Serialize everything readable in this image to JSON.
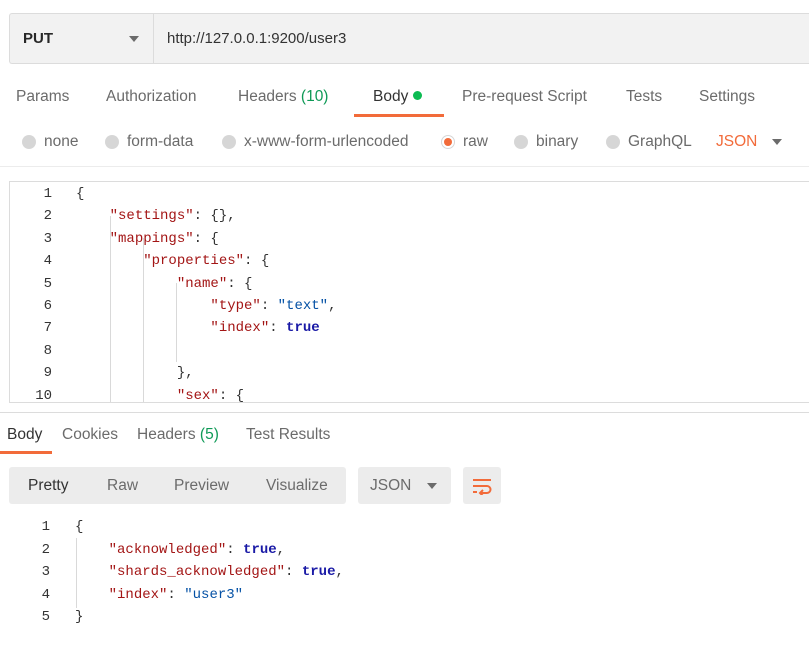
{
  "request": {
    "method": "PUT",
    "url": "http://127.0.0.1:9200/user3"
  },
  "request_tabs": [
    {
      "label": "Params"
    },
    {
      "label": "Authorization"
    },
    {
      "label": "Headers",
      "count": "(10)"
    },
    {
      "label": "Body",
      "active": true
    },
    {
      "label": "Pre-request Script"
    },
    {
      "label": "Tests"
    },
    {
      "label": "Settings"
    }
  ],
  "body_types": [
    {
      "label": "none"
    },
    {
      "label": "form-data"
    },
    {
      "label": "x-www-form-urlencoded"
    },
    {
      "label": "raw",
      "checked": true
    },
    {
      "label": "binary"
    },
    {
      "label": "GraphQL"
    }
  ],
  "raw_language": "JSON",
  "request_body_lines": [
    {
      "n": "1",
      "text": "{"
    },
    {
      "n": "2",
      "text": "    \"settings\": {},"
    },
    {
      "n": "3",
      "text": "    \"mappings\": {"
    },
    {
      "n": "4",
      "text": "        \"properties\": {"
    },
    {
      "n": "5",
      "text": "            \"name\": {"
    },
    {
      "n": "6",
      "text": "                \"type\": \"text\","
    },
    {
      "n": "7",
      "text": "                \"index\": true"
    },
    {
      "n": "8",
      "text": ""
    },
    {
      "n": "9",
      "text": "            },"
    },
    {
      "n": "10",
      "text": "            \"sex\": {"
    }
  ],
  "response_tabs": [
    {
      "label": "Body",
      "active": true
    },
    {
      "label": "Cookies"
    },
    {
      "label": "Headers",
      "count": "(5)"
    },
    {
      "label": "Test Results"
    }
  ],
  "view_modes": [
    {
      "label": "Pretty",
      "active": true
    },
    {
      "label": "Raw"
    },
    {
      "label": "Preview"
    },
    {
      "label": "Visualize"
    }
  ],
  "response_format": "JSON",
  "response_body_lines": [
    {
      "n": "1",
      "text": "{"
    },
    {
      "n": "2",
      "text": "    \"acknowledged\": true,"
    },
    {
      "n": "3",
      "text": "    \"shards_acknowledged\": true,"
    },
    {
      "n": "4",
      "text": "    \"index\": \"user3\""
    },
    {
      "n": "5",
      "text": "}"
    }
  ],
  "colors": {
    "accent": "#f26b3a",
    "count_green": "#0f9a57",
    "status_dot": "#0cbb52",
    "json_key": "#a31515",
    "json_string": "#0451a5",
    "json_literal": "#1a1aa6"
  },
  "icons": {
    "wrap": "wrap-lines-icon",
    "dropdown": "chevron-down-icon"
  }
}
